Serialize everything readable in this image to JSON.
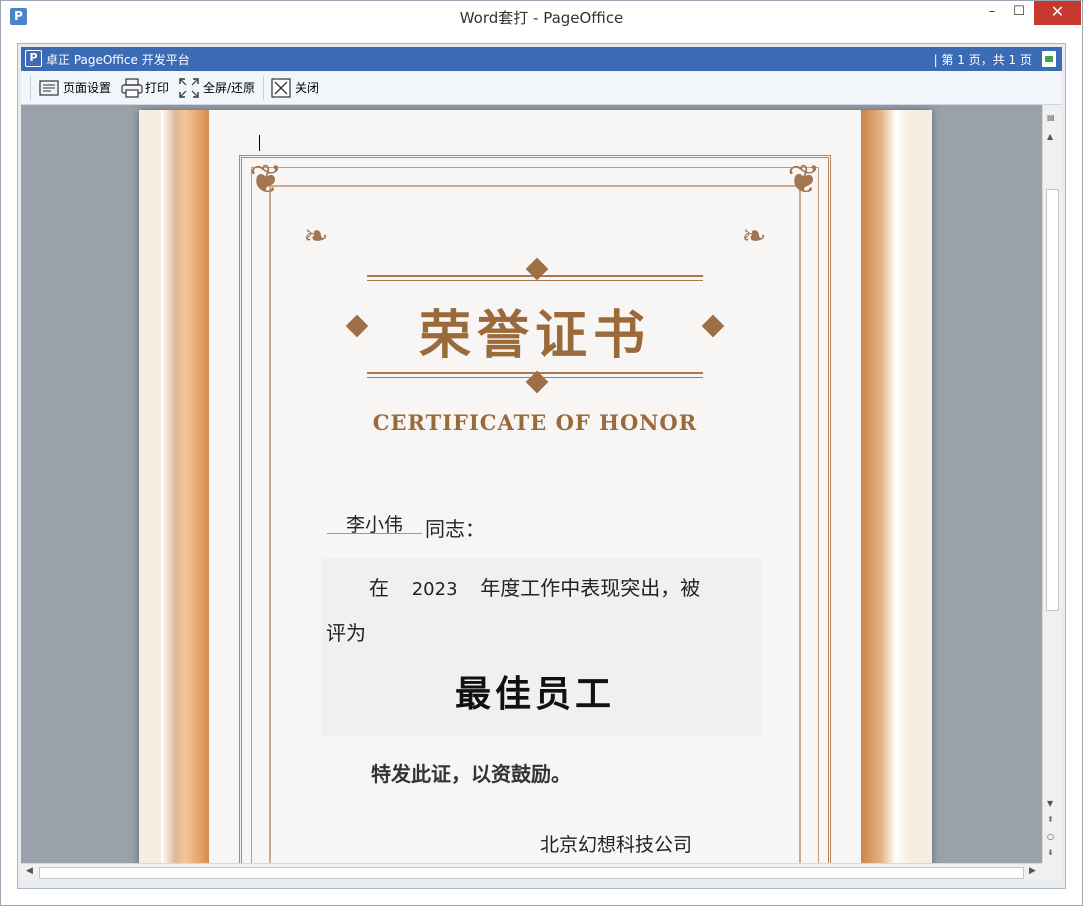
{
  "window": {
    "title": "Word套打 - PageOffice",
    "icon_letter": "P",
    "min_glyph": "–",
    "max_glyph": "☐",
    "close_glyph": "✕"
  },
  "pageoffice_bar": {
    "logo_letter": "P",
    "brand": "卓正 PageOffice 开发平台",
    "page_info": "| 第 1 页，共 1 页"
  },
  "toolbar": {
    "page_setup": "页面设置",
    "print": "打印",
    "fullscreen": "全屏/还原",
    "close": "关闭"
  },
  "certificate": {
    "title": "荣誉证书",
    "subtitle": "CERTIFICATE OF HONOR",
    "recipient": "李小伟",
    "salutation": "同志：",
    "line1_prefix": "在",
    "year": "2023",
    "line1_suffix": "年度工作中表现突出，被",
    "line2": "评为",
    "award": "最佳员工",
    "closing": "特发此证，以资鼓励。",
    "issuer": "北京幻想科技公司"
  }
}
